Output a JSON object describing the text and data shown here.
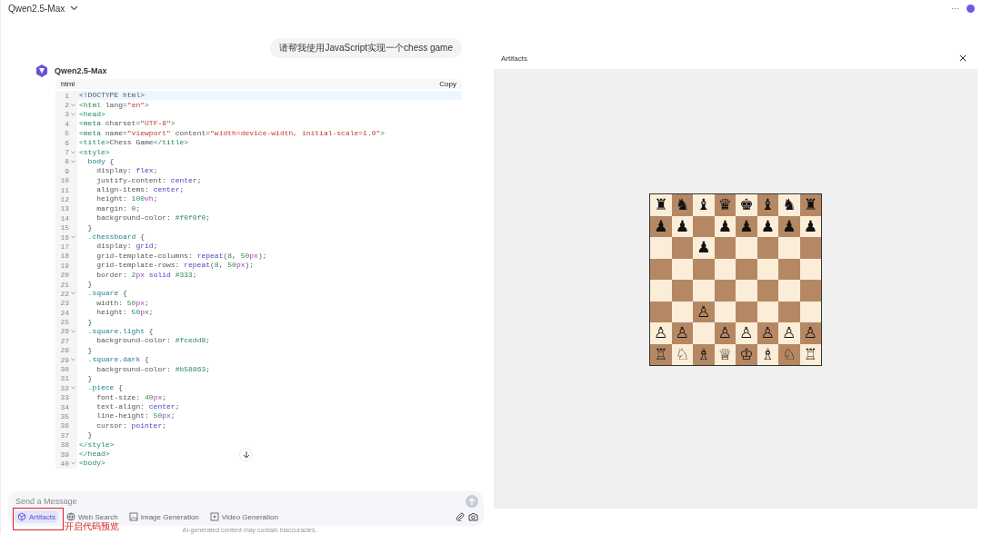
{
  "header": {
    "model": "Qwen2.5-Max",
    "more": "···"
  },
  "chat": {
    "user_message": "请帮我使用JavaScript实现一个chess game",
    "assistant_name": "Qwen2.5-Max",
    "code_block": {
      "language": "html",
      "copy": "Copy",
      "lines": [
        {
          "n": "1",
          "fold": false,
          "t": [
            {
              "text": "<!DOCTYPE html>",
              "kind": "p"
            }
          ]
        },
        {
          "n": "2",
          "fold": true,
          "t": [
            {
              "text": "<html",
              "kind": "tag"
            },
            {
              "text": " lang=",
              "kind": "p"
            },
            {
              "text": "\"en\"",
              "kind": "str"
            },
            {
              "text": ">",
              "kind": "tag"
            }
          ]
        },
        {
          "n": "3",
          "fold": true,
          "t": [
            {
              "text": "<head>",
              "kind": "tag"
            }
          ]
        },
        {
          "n": "4",
          "fold": false,
          "t": [
            {
              "text": "<meta",
              "kind": "tag"
            },
            {
              "text": " charset=",
              "kind": "p"
            },
            {
              "text": "\"UTF-8\"",
              "kind": "str"
            },
            {
              "text": ">",
              "kind": "tag"
            }
          ]
        },
        {
          "n": "5",
          "fold": false,
          "t": [
            {
              "text": "<meta",
              "kind": "tag"
            },
            {
              "text": " name=",
              "kind": "p"
            },
            {
              "text": "\"viewport\"",
              "kind": "str"
            },
            {
              "text": " content=",
              "kind": "p"
            },
            {
              "text": "\"width=device-width, initial-scale=1.0\"",
              "kind": "str"
            },
            {
              "text": ">",
              "kind": "tag"
            }
          ]
        },
        {
          "n": "6",
          "fold": false,
          "t": [
            {
              "text": "<title>",
              "kind": "tag"
            },
            {
              "text": "Chess Game",
              "kind": "p"
            },
            {
              "text": "</title>",
              "kind": "tag"
            }
          ]
        },
        {
          "n": "7",
          "fold": true,
          "t": [
            {
              "text": "<style>",
              "kind": "tag"
            }
          ]
        },
        {
          "n": "8",
          "fold": true,
          "t": [
            {
              "text": "  body",
              "kind": "sel"
            },
            {
              "text": " {",
              "kind": "p"
            }
          ]
        },
        {
          "n": "9",
          "fold": false,
          "t": [
            {
              "text": "    display: ",
              "kind": "p"
            },
            {
              "text": "flex",
              "kind": "kw"
            },
            {
              "text": ";",
              "kind": "p"
            }
          ]
        },
        {
          "n": "10",
          "fold": false,
          "t": [
            {
              "text": "    justify-content: ",
              "kind": "p"
            },
            {
              "text": "center",
              "kind": "kw"
            },
            {
              "text": ";",
              "kind": "p"
            }
          ]
        },
        {
          "n": "11",
          "fold": false,
          "t": [
            {
              "text": "    align-items: ",
              "kind": "p"
            },
            {
              "text": "center",
              "kind": "kw"
            },
            {
              "text": ";",
              "kind": "p"
            }
          ]
        },
        {
          "n": "12",
          "fold": false,
          "t": [
            {
              "text": "    height: ",
              "kind": "p"
            },
            {
              "text": "100",
              "kind": "num"
            },
            {
              "text": "vh",
              "kind": "unit"
            },
            {
              "text": ";",
              "kind": "p"
            }
          ]
        },
        {
          "n": "13",
          "fold": false,
          "t": [
            {
              "text": "    margin: ",
              "kind": "p"
            },
            {
              "text": "0",
              "kind": "num"
            },
            {
              "text": ";",
              "kind": "p"
            }
          ]
        },
        {
          "n": "14",
          "fold": false,
          "t": [
            {
              "text": "    background-color: ",
              "kind": "p"
            },
            {
              "text": "#f0f0f0",
              "kind": "num"
            },
            {
              "text": ";",
              "kind": "p"
            }
          ]
        },
        {
          "n": "15",
          "fold": false,
          "t": [
            {
              "text": "  }",
              "kind": "p"
            }
          ]
        },
        {
          "n": "16",
          "fold": true,
          "t": [
            {
              "text": "  .chessboard",
              "kind": "sel"
            },
            {
              "text": " {",
              "kind": "p"
            }
          ]
        },
        {
          "n": "17",
          "fold": false,
          "t": [
            {
              "text": "    display: ",
              "kind": "p"
            },
            {
              "text": "grid",
              "kind": "kw"
            },
            {
              "text": ";",
              "kind": "p"
            }
          ]
        },
        {
          "n": "18",
          "fold": false,
          "t": [
            {
              "text": "    grid-template-columns: ",
              "kind": "p"
            },
            {
              "text": "repeat",
              "kind": "kw"
            },
            {
              "text": "(",
              "kind": "p"
            },
            {
              "text": "8",
              "kind": "num"
            },
            {
              "text": ", ",
              "kind": "p"
            },
            {
              "text": "50",
              "kind": "num"
            },
            {
              "text": "px",
              "kind": "unit"
            },
            {
              "text": ");",
              "kind": "p"
            }
          ]
        },
        {
          "n": "19",
          "fold": false,
          "t": [
            {
              "text": "    grid-template-rows: ",
              "kind": "p"
            },
            {
              "text": "repeat",
              "kind": "kw"
            },
            {
              "text": "(",
              "kind": "p"
            },
            {
              "text": "8",
              "kind": "num"
            },
            {
              "text": ", ",
              "kind": "p"
            },
            {
              "text": "50",
              "kind": "num"
            },
            {
              "text": "px",
              "kind": "unit"
            },
            {
              "text": ");",
              "kind": "p"
            }
          ]
        },
        {
          "n": "20",
          "fold": false,
          "t": [
            {
              "text": "    border: ",
              "kind": "p"
            },
            {
              "text": "2",
              "kind": "num"
            },
            {
              "text": "px",
              "kind": "unit"
            },
            {
              "text": " solid ",
              "kind": "kw"
            },
            {
              "text": "#333",
              "kind": "num"
            },
            {
              "text": ";",
              "kind": "p"
            }
          ]
        },
        {
          "n": "21",
          "fold": false,
          "t": [
            {
              "text": "  }",
              "kind": "p"
            }
          ]
        },
        {
          "n": "22",
          "fold": true,
          "t": [
            {
              "text": "  .square",
              "kind": "sel"
            },
            {
              "text": " {",
              "kind": "p"
            }
          ]
        },
        {
          "n": "23",
          "fold": false,
          "t": [
            {
              "text": "    width: ",
              "kind": "p"
            },
            {
              "text": "50",
              "kind": "num"
            },
            {
              "text": "px",
              "kind": "unit"
            },
            {
              "text": ";",
              "kind": "p"
            }
          ]
        },
        {
          "n": "24",
          "fold": false,
          "t": [
            {
              "text": "    height: ",
              "kind": "p"
            },
            {
              "text": "50",
              "kind": "num"
            },
            {
              "text": "px",
              "kind": "unit"
            },
            {
              "text": ";",
              "kind": "p"
            }
          ]
        },
        {
          "n": "25",
          "fold": false,
          "t": [
            {
              "text": "  }",
              "kind": "p"
            }
          ]
        },
        {
          "n": "26",
          "fold": true,
          "t": [
            {
              "text": "  .square.light",
              "kind": "sel"
            },
            {
              "text": " {",
              "kind": "p"
            }
          ]
        },
        {
          "n": "27",
          "fold": false,
          "t": [
            {
              "text": "    background-color: ",
              "kind": "p"
            },
            {
              "text": "#fcedd8",
              "kind": "num"
            },
            {
              "text": ";",
              "kind": "p"
            }
          ]
        },
        {
          "n": "28",
          "fold": false,
          "t": [
            {
              "text": "  }",
              "kind": "p"
            }
          ]
        },
        {
          "n": "29",
          "fold": true,
          "t": [
            {
              "text": "  .square.dark",
              "kind": "sel"
            },
            {
              "text": " {",
              "kind": "p"
            }
          ]
        },
        {
          "n": "30",
          "fold": false,
          "t": [
            {
              "text": "    background-color: ",
              "kind": "p"
            },
            {
              "text": "#b58863",
              "kind": "num"
            },
            {
              "text": ";",
              "kind": "p"
            }
          ]
        },
        {
          "n": "31",
          "fold": false,
          "t": [
            {
              "text": "  }",
              "kind": "p"
            }
          ]
        },
        {
          "n": "32",
          "fold": true,
          "t": [
            {
              "text": "  .piece",
              "kind": "sel"
            },
            {
              "text": " {",
              "kind": "p"
            }
          ]
        },
        {
          "n": "33",
          "fold": false,
          "t": [
            {
              "text": "    font-size: ",
              "kind": "p"
            },
            {
              "text": "40",
              "kind": "num"
            },
            {
              "text": "px",
              "kind": "unit"
            },
            {
              "text": ";",
              "kind": "p"
            }
          ]
        },
        {
          "n": "34",
          "fold": false,
          "t": [
            {
              "text": "    text-align: ",
              "kind": "p"
            },
            {
              "text": "center",
              "kind": "kw"
            },
            {
              "text": ";",
              "kind": "p"
            }
          ]
        },
        {
          "n": "35",
          "fold": false,
          "t": [
            {
              "text": "    line-height: ",
              "kind": "p"
            },
            {
              "text": "50",
              "kind": "num"
            },
            {
              "text": "px",
              "kind": "unit"
            },
            {
              "text": ";",
              "kind": "p"
            }
          ]
        },
        {
          "n": "36",
          "fold": false,
          "t": [
            {
              "text": "    cursor: ",
              "kind": "p"
            },
            {
              "text": "pointer",
              "kind": "kw"
            },
            {
              "text": ";",
              "kind": "p"
            }
          ]
        },
        {
          "n": "37",
          "fold": false,
          "t": [
            {
              "text": "  }",
              "kind": "p"
            }
          ]
        },
        {
          "n": "38",
          "fold": false,
          "t": [
            {
              "text": "</style>",
              "kind": "tag"
            }
          ]
        },
        {
          "n": "39",
          "fold": false,
          "t": [
            {
              "text": "</head>",
              "kind": "tag"
            }
          ]
        },
        {
          "n": "40",
          "fold": true,
          "t": [
            {
              "text": "<body>",
              "kind": "tag"
            }
          ]
        }
      ]
    }
  },
  "input": {
    "placeholder": "Send a Message",
    "tools": [
      {
        "kind": "artifacts",
        "label": "Artifacts",
        "selected": true
      },
      {
        "kind": "web",
        "label": "Web Search",
        "selected": false
      },
      {
        "kind": "image",
        "label": "Image Generation",
        "selected": false
      },
      {
        "kind": "video",
        "label": "Video Generation",
        "selected": false
      }
    ],
    "annotation": "开启代码预览"
  },
  "footer": "AI-generated content may contain inaccuracies.",
  "artifacts": {
    "title": "Artifacts",
    "board": [
      [
        {
          "kind": "piece",
          "piece": "♜"
        },
        {
          "kind": "piece",
          "piece": "♞"
        },
        {
          "kind": "piece",
          "piece": "♝"
        },
        {
          "kind": "piece",
          "piece": "♛"
        },
        {
          "kind": "piece",
          "piece": "♚"
        },
        {
          "kind": "piece",
          "piece": "♝"
        },
        {
          "kind": "piece",
          "piece": "♞"
        },
        {
          "kind": "piece",
          "piece": "♜"
        }
      ],
      [
        {
          "kind": "piece",
          "piece": "♟"
        },
        {
          "kind": "piece",
          "piece": "♟"
        },
        {
          "kind": "empty"
        },
        {
          "kind": "piece",
          "piece": "♟"
        },
        {
          "kind": "piece",
          "piece": "♟"
        },
        {
          "kind": "piece",
          "piece": "♟"
        },
        {
          "kind": "piece",
          "piece": "♟"
        },
        {
          "kind": "piece",
          "piece": "♟"
        }
      ],
      [
        {
          "kind": "empty"
        },
        {
          "kind": "empty"
        },
        {
          "kind": "piece",
          "piece": "♟"
        },
        {
          "kind": "empty"
        },
        {
          "kind": "empty"
        },
        {
          "kind": "empty"
        },
        {
          "kind": "empty"
        },
        {
          "kind": "empty"
        }
      ],
      [
        {
          "kind": "empty"
        },
        {
          "kind": "empty"
        },
        {
          "kind": "empty"
        },
        {
          "kind": "empty"
        },
        {
          "kind": "empty"
        },
        {
          "kind": "empty"
        },
        {
          "kind": "empty"
        },
        {
          "kind": "empty"
        }
      ],
      [
        {
          "kind": "empty"
        },
        {
          "kind": "empty"
        },
        {
          "kind": "empty"
        },
        {
          "kind": "empty"
        },
        {
          "kind": "empty"
        },
        {
          "kind": "empty"
        },
        {
          "kind": "empty"
        },
        {
          "kind": "empty"
        }
      ],
      [
        {
          "kind": "empty"
        },
        {
          "kind": "empty"
        },
        {
          "kind": "piece",
          "piece": "♙"
        },
        {
          "kind": "empty"
        },
        {
          "kind": "empty"
        },
        {
          "kind": "empty"
        },
        {
          "kind": "empty"
        },
        {
          "kind": "empty"
        }
      ],
      [
        {
          "kind": "piece",
          "piece": "♙"
        },
        {
          "kind": "piece",
          "piece": "♙"
        },
        {
          "kind": "empty"
        },
        {
          "kind": "piece",
          "piece": "♙"
        },
        {
          "kind": "piece",
          "piece": "♙"
        },
        {
          "kind": "piece",
          "piece": "♙"
        },
        {
          "kind": "piece",
          "piece": "♙"
        },
        {
          "kind": "piece",
          "piece": "♙"
        }
      ],
      [
        {
          "kind": "piece",
          "piece": "♖"
        },
        {
          "kind": "piece",
          "piece": "♘"
        },
        {
          "kind": "piece",
          "piece": "♗"
        },
        {
          "kind": "piece",
          "piece": "♕"
        },
        {
          "kind": "piece",
          "piece": "♔"
        },
        {
          "kind": "piece",
          "piece": "♗"
        },
        {
          "kind": "piece",
          "piece": "♘"
        },
        {
          "kind": "piece",
          "piece": "♖"
        }
      ]
    ]
  }
}
